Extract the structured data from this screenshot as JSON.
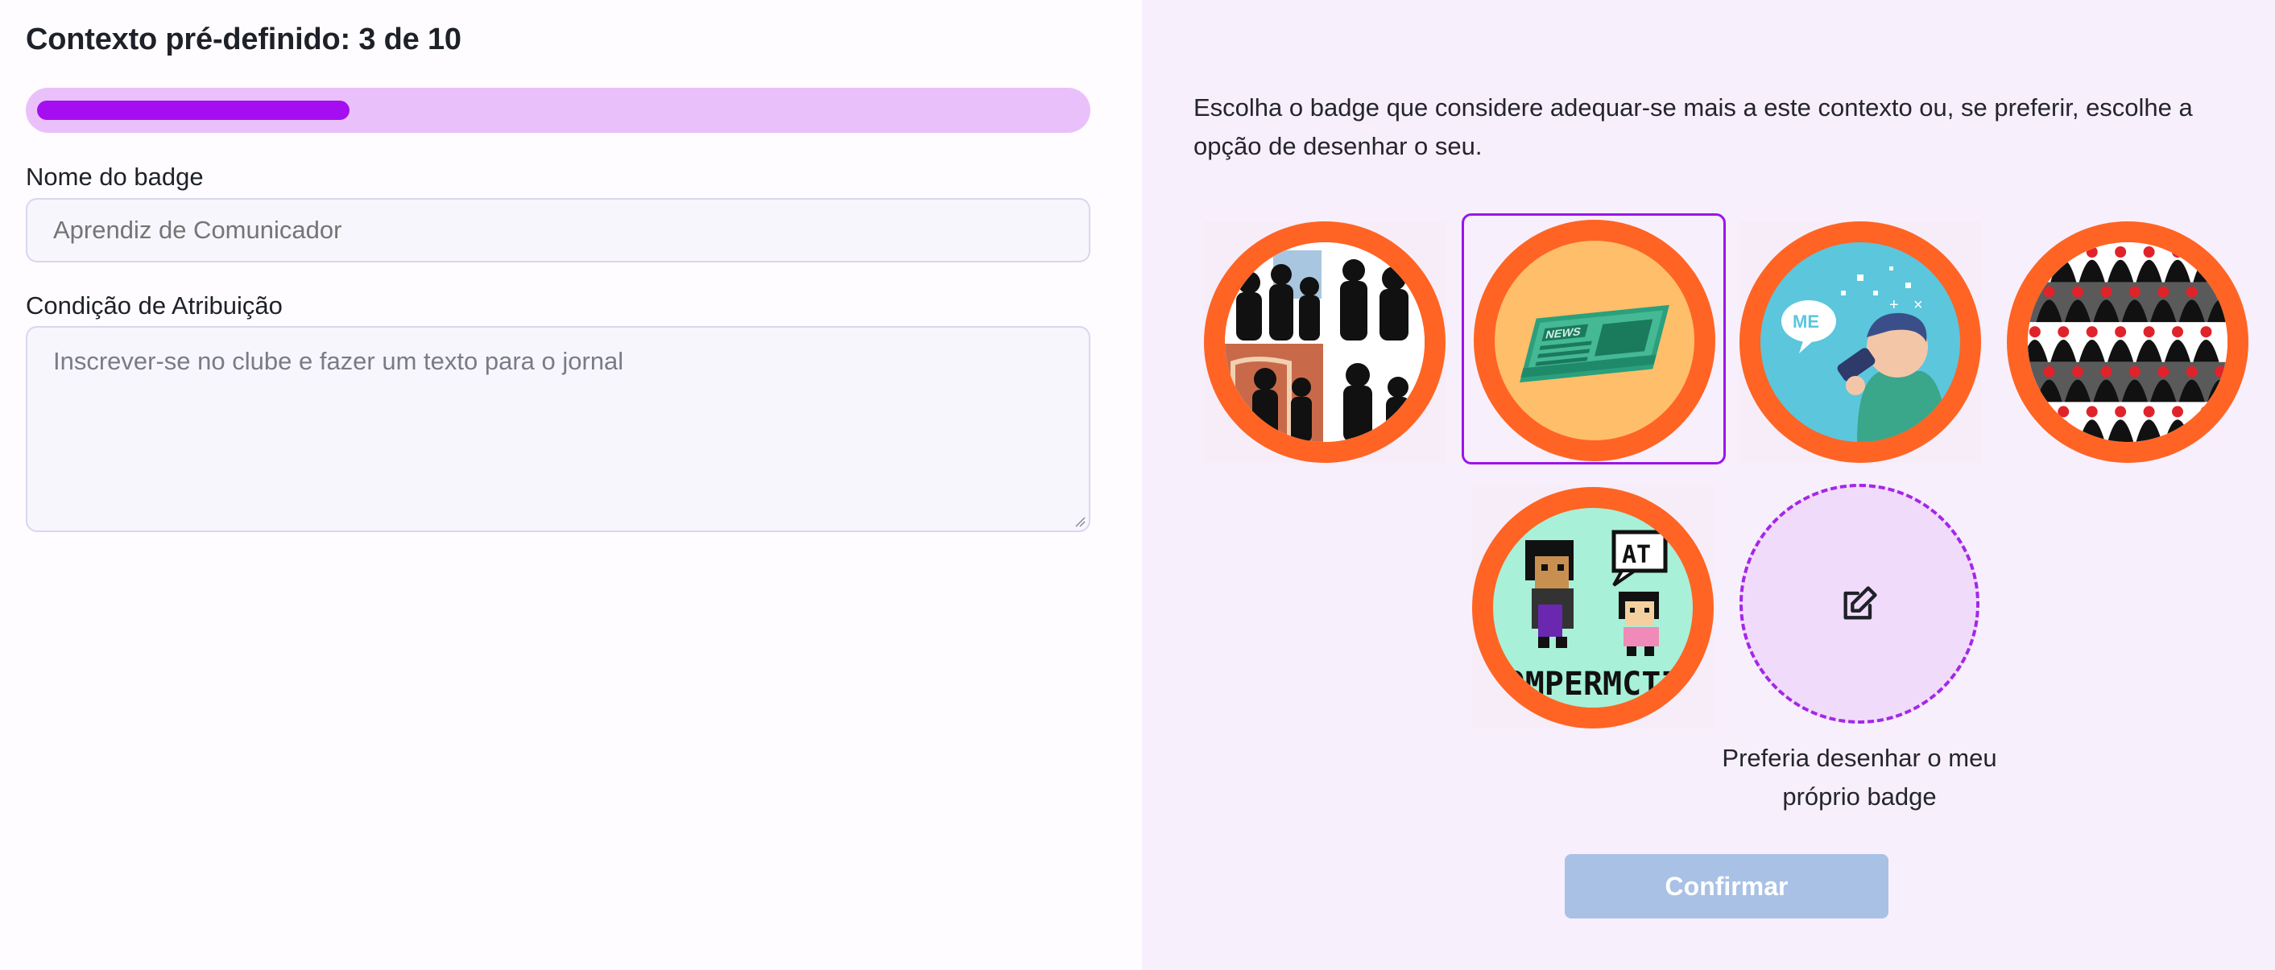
{
  "header": {
    "title": "Contexto pré-definido: 3 de 10"
  },
  "progress": {
    "current": 3,
    "total": 10,
    "fraction": 0.3
  },
  "form": {
    "name_label": "Nome do badge",
    "name_placeholder": "Aprendiz de Comunicador",
    "condition_label": "Condição de Atribuição",
    "condition_placeholder": "Inscrever-se no clube e fazer um texto para o jornal"
  },
  "chooser": {
    "instructions": "Escolha o badge que considere adequar-se mais a este contexto ou, se preferir, escolhe a opção de desenhar o seu.",
    "badges": [
      {
        "name": "silhouettes-badge",
        "selected": false
      },
      {
        "name": "newspaper-badge",
        "selected": true
      },
      {
        "name": "megaphone-badge",
        "selected": false
      },
      {
        "name": "pattern-badge",
        "selected": false
      },
      {
        "name": "pixel-conversation-badge",
        "selected": false
      }
    ],
    "newspaper_text": "NEWS",
    "pixel_text": "COMPERMCTIC",
    "speech_text": "AT",
    "megaphone_text": "ME",
    "draw_option_label": "Preferia desenhar o meu próprio badge",
    "draw_icon": "edit-icon",
    "confirm_label": "Confirmar"
  },
  "colors": {
    "accent": "#a60ef2",
    "progress_track": "#eac0fa",
    "badge_ring": "#ff6424",
    "confirm_disabled": "#a9c1e5",
    "right_panel_bg": "#f8effc"
  }
}
